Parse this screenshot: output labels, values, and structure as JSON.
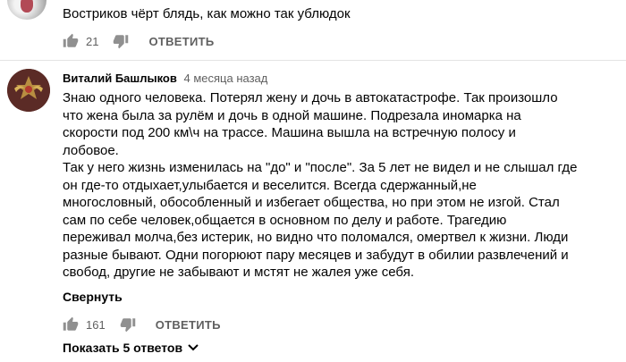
{
  "previous_comment": {
    "text": "Востриков чёрт блядь, как можно так ублюдок",
    "like_count": "21",
    "reply_label": "ОТВЕТИТЬ"
  },
  "comment": {
    "author": "Виталий Башлыков",
    "time": "4 месяца назад",
    "text": "Знаю одного человека. Потерял жену и дочь в автокатастрофе. Так произошло\nчто жена была за рулём и дочь в одной машине. Подрезала иномарка на\nскорости под 200 км\\ч  на трассе. Машина вышла на встречную полосу и\nлобовое.\nТак у него жизнь изменилась на \"до\" и \"после\".  За 5 лет не видел и не слышал где\nон где-то отдыхает,улыбается и веселится.  Всегда сдержанный,не\nмногословный, обособленный и избегает общества, но при этом не изгой. Стал\nсам по себе человек,общается в основном по делу и работе.  Трагедию\nпереживал молча,без истерик, но видно что поломался, омертвел к жизни. Люди\nразные бывают. Одни погорюют пару месяцев и забудут в обилии развлечений и\nсвобод, другие не забывают и мстят не жалея уже себя.",
    "collapse_label": "Свернуть",
    "like_count": "161",
    "reply_label": "ОТВЕТИТЬ",
    "show_replies_label": "Показать 5 ответов"
  },
  "icons": [
    "thumbs-up-icon",
    "thumbs-down-icon",
    "chevron-down-icon"
  ],
  "colors": {
    "text": "#030303",
    "secondary": "#606060",
    "divider": "#e3e3e3"
  }
}
